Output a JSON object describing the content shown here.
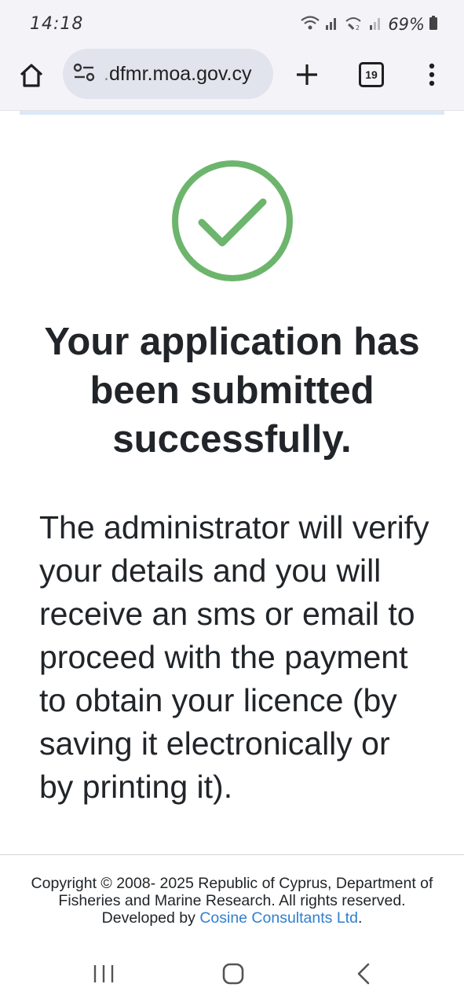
{
  "status_bar": {
    "time": "14:18",
    "battery": "69%"
  },
  "browser": {
    "url_prefix": ".",
    "url_host": "dfmr.moa.gov.cy",
    "tab_count": "19"
  },
  "confirmation": {
    "headline": "Your application has been submitted successfully.",
    "message": "The administrator will verify your details and you will receive an sms or email to proceed with the payment to obtain your licence (by saving it electronically or by printing it).",
    "check_color": "#6db56d"
  },
  "footer": {
    "copyright": "Copyright © 2008- 2025 Republic of Cyprus, Department of Fisheries and Marine Research. All rights reserved.",
    "developed_by_prefix": "Developed by ",
    "developer_link": "Cosine Consultants Ltd",
    "developed_by_suffix": ".",
    "link_color": "#2f7fd1"
  },
  "icons": {
    "home": "home-icon",
    "site_info": "tune-icon",
    "new_tab": "plus-icon",
    "menu": "more-vert-icon",
    "nav_recents": "recents-icon",
    "nav_home": "home-circle-icon",
    "nav_back": "back-icon"
  }
}
